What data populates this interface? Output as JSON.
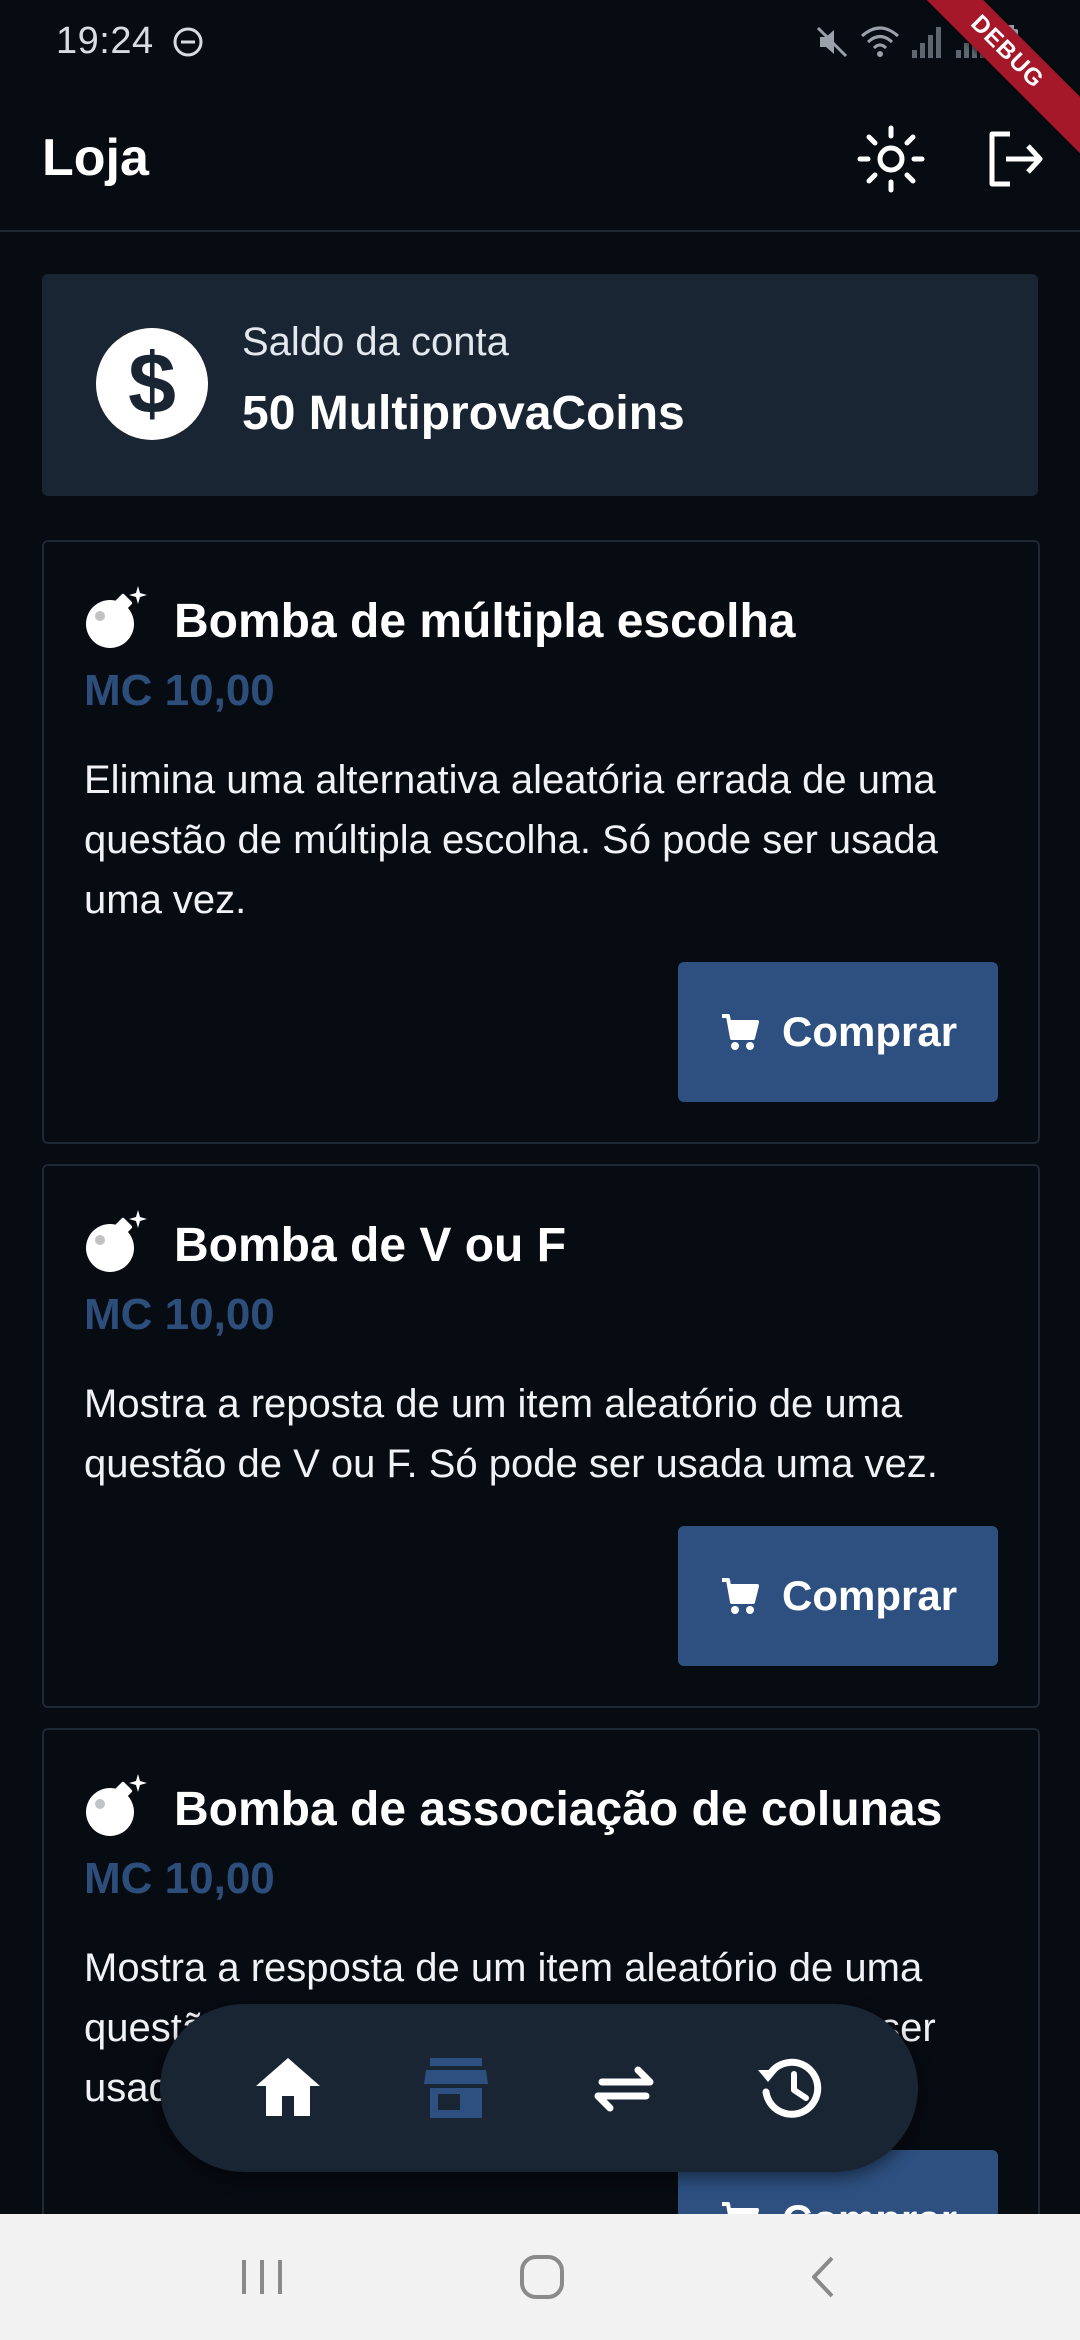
{
  "status_bar": {
    "time": "19:24",
    "debug_label": "DEBUG",
    "icons": [
      "do-not-disturb-icon",
      "mute-icon",
      "wifi-icon",
      "signal-icon",
      "signal-icon",
      "battery-icon"
    ]
  },
  "app_bar": {
    "title": "Loja",
    "actions": [
      "theme-toggle-icon",
      "logout-icon"
    ]
  },
  "balance": {
    "label": "Saldo da conta",
    "value": "50 MultiprovaCoins",
    "icon": "dollar-icon"
  },
  "products": [
    {
      "title": "Bomba de múltipla escolha",
      "price": "MC 10,00",
      "description": "Elimina uma alternativa aleatória errada de uma questão de múltipla escolha. Só pode ser usada uma vez.",
      "button_label": "Comprar",
      "icon": "bomb-icon"
    },
    {
      "title": "Bomba de V ou F",
      "price": "MC 10,00",
      "description": "Mostra a reposta de um item aleatório de uma questão de V ou F. Só pode ser usada uma vez.",
      "button_label": "Comprar",
      "icon": "bomb-icon"
    },
    {
      "title": "Bomba de associação de colunas",
      "price": "MC 10,00",
      "description": "Mostra a resposta de um item aleatório de uma questão de associação de colunas. Só pode ser usada uma vez.",
      "button_label": "Comprar",
      "icon": "bomb-icon"
    }
  ],
  "bottom_nav": {
    "items": [
      "home-icon",
      "store-icon",
      "swap-icon",
      "history-icon"
    ],
    "active": "store-icon"
  },
  "colors": {
    "background": "#070B12",
    "card": "#1A2533",
    "accent": "#2D5080",
    "price": "#2D4E7A"
  }
}
